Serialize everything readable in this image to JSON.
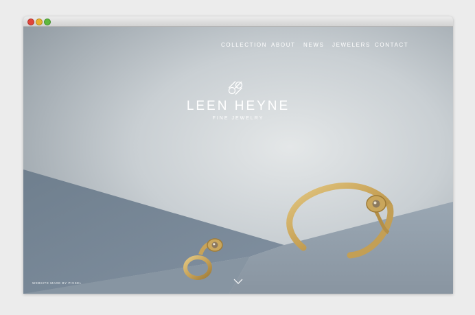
{
  "window": {
    "controls": [
      "close",
      "minimize",
      "zoom"
    ]
  },
  "nav": {
    "items": [
      {
        "label": "COLLECTION"
      },
      {
        "label": "ABOUT"
      },
      {
        "label": "NEWS"
      },
      {
        "label": "JEWELERS"
      },
      {
        "label": "CONTACT"
      }
    ]
  },
  "brand": {
    "logo_icon": "infinity-knot-icon",
    "name": "LEEN HEYNE",
    "tagline": "FINE JEWELRY"
  },
  "footer": {
    "credit": "WEBSITE MADE BY PIXSEL",
    "scroll_icon": "chevron-down-icon"
  },
  "colors": {
    "background_light": "#d9dde0",
    "background_dark": "#7d8790",
    "floor_blue": "#8494a2",
    "gold": "#c9a75b"
  }
}
